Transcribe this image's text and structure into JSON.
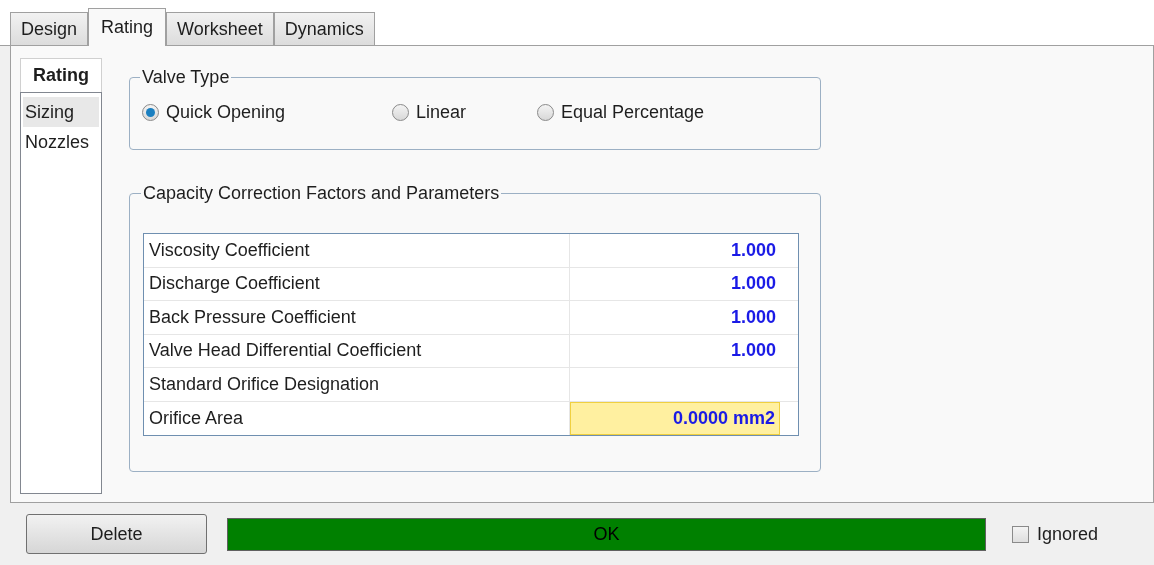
{
  "tabs": [
    {
      "label": "Design",
      "selected": false
    },
    {
      "label": "Rating",
      "selected": true
    },
    {
      "label": "Worksheet",
      "selected": false
    },
    {
      "label": "Dynamics",
      "selected": false
    }
  ],
  "sidebar": {
    "header": "Rating",
    "items": [
      {
        "label": "Sizing",
        "selected": true
      },
      {
        "label": "Nozzles",
        "selected": false
      }
    ]
  },
  "valve_type": {
    "title": "Valve Type",
    "options": [
      {
        "label": "Quick Opening",
        "selected": true
      },
      {
        "label": "Linear",
        "selected": false
      },
      {
        "label": "Equal Percentage",
        "selected": false
      }
    ]
  },
  "capacity": {
    "title": "Capacity Correction Factors and Parameters",
    "rows": [
      {
        "label": "Viscosity Coefficient",
        "value": "1.000",
        "highlighted": false
      },
      {
        "label": "Discharge Coefficient",
        "value": "1.000",
        "highlighted": false
      },
      {
        "label": "Back Pressure Coefficient",
        "value": "1.000",
        "highlighted": false
      },
      {
        "label": "Valve Head Differential Coefficient",
        "value": "1.000",
        "highlighted": false
      },
      {
        "label": "Standard Orifice Designation",
        "highlighted": false
      },
      {
        "label": "Orifice Area",
        "value": "0.0000 mm2",
        "highlighted": true
      }
    ]
  },
  "footer": {
    "delete_button": "Delete",
    "status": {
      "text": "OK",
      "kind": "ok"
    },
    "ignored": {
      "label": "Ignored",
      "checked": false
    }
  }
}
